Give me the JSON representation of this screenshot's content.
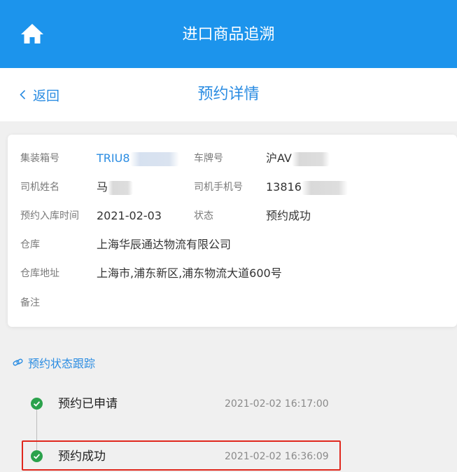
{
  "app": {
    "title": "进口商品追溯"
  },
  "nav": {
    "back_label": "返回",
    "page_title": "预约详情"
  },
  "details": {
    "container_no": {
      "label": "集装箱号",
      "value": "TRIU8"
    },
    "plate_no": {
      "label": "车牌号",
      "value": "沪AV"
    },
    "driver_name": {
      "label": "司机姓名",
      "value": "马"
    },
    "driver_phone": {
      "label": "司机手机号",
      "value": "13816"
    },
    "booking_date": {
      "label": "预约入库时间",
      "value": "2021-02-03"
    },
    "status": {
      "label": "状态",
      "value": "预约成功"
    },
    "warehouse": {
      "label": "仓库",
      "value": "上海华辰通达物流有限公司"
    },
    "address": {
      "label": "仓库地址",
      "value": "上海市,浦东新区,浦东物流大道600号"
    },
    "remark": {
      "label": "备注",
      "value": ""
    }
  },
  "tracking": {
    "title": "预约状态跟踪",
    "steps": [
      {
        "label": "预约已申请",
        "time": "2021-02-02 16:17:00"
      },
      {
        "label": "预约成功",
        "time": "2021-02-02 16:36:09"
      }
    ]
  },
  "colors": {
    "header": "#1c94ec",
    "accent": "#2a8ce2",
    "success": "#2ba24c",
    "highlight": "#e0281e"
  },
  "icons": {
    "home": "home-icon",
    "back": "chevron-left-icon",
    "tracking": "link-icon",
    "step": "check-circle-icon"
  }
}
